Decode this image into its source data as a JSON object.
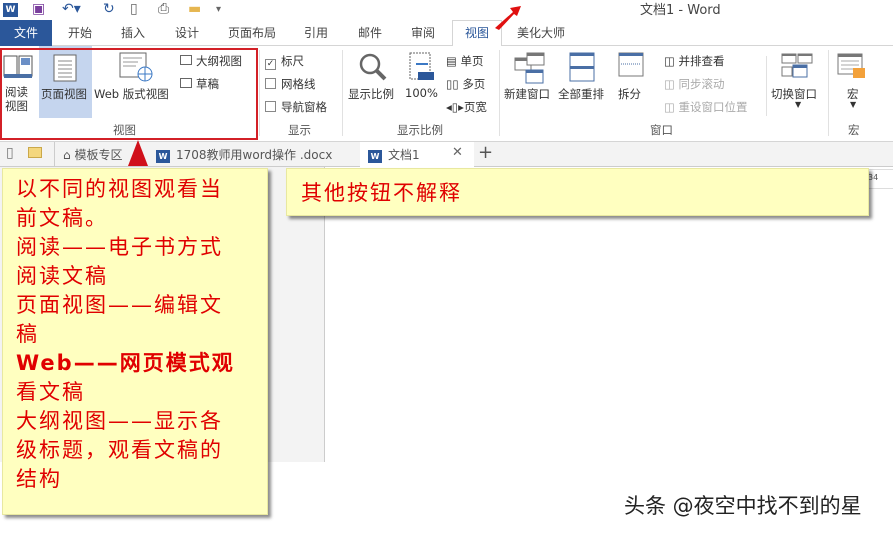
{
  "window": {
    "title": "文档1 - Word"
  },
  "menu_tabs": [
    "文件",
    "开始",
    "插入",
    "设计",
    "页面布局",
    "引用",
    "邮件",
    "审阅",
    "视图",
    "美化大师"
  ],
  "ribbon": {
    "views": {
      "read": "阅读\n视图",
      "read_l1": "阅读",
      "read_l2": "视图",
      "print_layout": "页面视图",
      "web_layout": "Web 版式视图",
      "outline": "大纲视图",
      "draft": "草稿",
      "group": "视图"
    },
    "show": {
      "ruler": "标尺",
      "gridlines": "网格线",
      "nav_pane": "导航窗格",
      "group": "显示"
    },
    "zoom": {
      "zoom": "显示比例",
      "hundred": "100%",
      "badge": "100",
      "one_page": "单页",
      "multi_page": "多页",
      "page_width": "页宽",
      "group": "显示比例"
    },
    "window": {
      "new_window": "新建窗口",
      "arrange_all": "全部重排",
      "split": "拆分",
      "side_by_side": "并排查看",
      "sync_scroll": "同步滚动",
      "reset_pos": "重设窗口位置",
      "switch": "切换窗口",
      "group": "窗口"
    },
    "macros": {
      "macro": "宏",
      "group": "宏"
    }
  },
  "doc_tabs": [
    {
      "label": "模板专区"
    },
    {
      "label": "1708教师用word操作 .docx"
    },
    {
      "label": "文档1"
    }
  ],
  "ruler_number": "34",
  "notes": {
    "left": [
      "以不同的视图观看当",
      "前文稿。",
      "阅读——电子书方式",
      "阅读文稿",
      "页面视图——编辑文",
      "稿",
      "Web——网页模式观",
      "看文稿",
      "大纲视图——显示各",
      "级标题，观看文稿的",
      "结构"
    ],
    "right": "其他按钮不解释"
  },
  "watermark": "头条 @夜空中找不到的星"
}
